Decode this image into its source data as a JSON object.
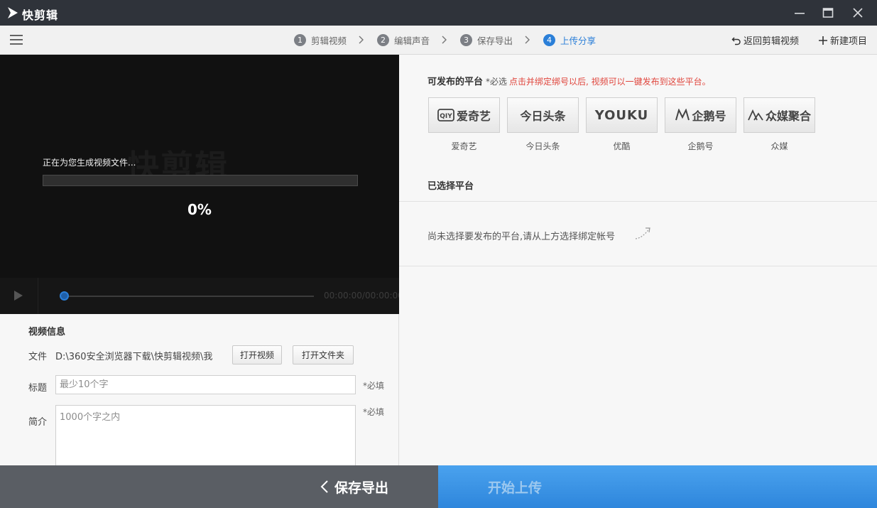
{
  "app": {
    "title": "快剪辑"
  },
  "steps": [
    {
      "num": "1",
      "label": "剪辑视频"
    },
    {
      "num": "2",
      "label": "编辑声音"
    },
    {
      "num": "3",
      "label": "保存导出"
    },
    {
      "num": "4",
      "label": "上传分享",
      "active": true
    }
  ],
  "top_actions": {
    "back_label": "返回剪辑视频",
    "new_label": "新建项目"
  },
  "video": {
    "watermark": "快剪辑",
    "generating_text": "正在为您生成视频文件...",
    "progress_text": "0%",
    "progress_value": 0,
    "timecode": "00:00:00/00:00:00"
  },
  "info": {
    "title": "视频信息",
    "file_label": "文件",
    "file_path": "D:\\360安全浏览器下载\\快剪辑视频\\我",
    "open_video_label": "打开视频",
    "open_folder_label": "打开文件夹",
    "title_label": "标题",
    "title_placeholder": "最少10个字",
    "title_required": "*必填",
    "desc_label": "简介",
    "desc_placeholder": "1000个字之内",
    "desc_required": "*必填"
  },
  "platforms_section": {
    "title": "可发布的平台",
    "required": "*必选",
    "hint": "点击并绑定绑号以后, 视频可以一键发布到这些平台。",
    "items": [
      {
        "logo_text": "爱奇艺",
        "label": "爱奇艺",
        "icon": "iqiyi-logo"
      },
      {
        "logo_text": "今日头条",
        "label": "今日头条",
        "icon": "toutiao-logo"
      },
      {
        "logo_text": "YOUKU",
        "label": "优酷",
        "icon": "youku-logo"
      },
      {
        "logo_text": "企鹅号",
        "label": "企鹅号",
        "icon": "qiehao-logo"
      },
      {
        "logo_text": "众媒聚合",
        "label": "众媒",
        "icon": "zhongmei-logo"
      }
    ]
  },
  "selected_section": {
    "title": "已选择平台",
    "empty_text": "尚未选择要发布的平台,请从上方选择绑定帐号"
  },
  "bottom": {
    "back_label": "保存导出",
    "upload_label": "开始上传"
  },
  "colors": {
    "accent": "#2b7fd8",
    "titlebar": "#2f333a",
    "hint_red": "#e0463d"
  }
}
